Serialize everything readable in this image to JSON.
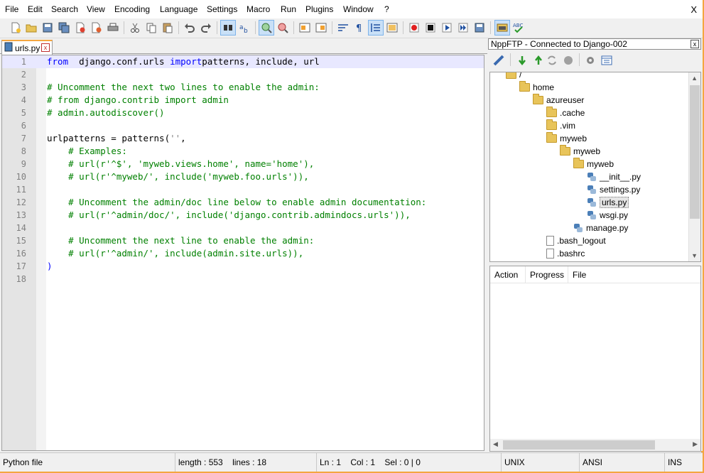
{
  "menu": {
    "items": [
      "File",
      "Edit",
      "Search",
      "View",
      "Encoding",
      "Language",
      "Settings",
      "Macro",
      "Run",
      "Plugins",
      "Window",
      "?"
    ],
    "close": "X"
  },
  "tab": {
    "label": "urls.py",
    "close": "x"
  },
  "editor": {
    "lines": [
      {
        "n": "1",
        "code": [
          [
            "kw",
            "from"
          ],
          [
            "",
            "  django.conf.urls "
          ],
          [
            "kw",
            "import"
          ],
          [
            "",
            "",
            " "
          ],
          [
            "",
            "patterns, include, url"
          ]
        ]
      },
      {
        "n": "2",
        "code": []
      },
      {
        "n": "3",
        "code": [
          [
            "cm",
            "# Uncomment the next two lines to enable the admin:"
          ]
        ]
      },
      {
        "n": "4",
        "code": [
          [
            "cm",
            "# from django.contrib import admin"
          ]
        ]
      },
      {
        "n": "5",
        "code": [
          [
            "cm",
            "# admin.autodiscover()"
          ]
        ]
      },
      {
        "n": "6",
        "code": []
      },
      {
        "n": "7",
        "code": [
          [
            "",
            "urlpatterns = patterns("
          ],
          [
            "st",
            "''"
          ],
          [
            "",
            ","
          ]
        ]
      },
      {
        "n": "8",
        "code": [
          [
            "",
            "    "
          ],
          [
            "cm",
            "# Examples:"
          ]
        ]
      },
      {
        "n": "9",
        "code": [
          [
            "",
            "    "
          ],
          [
            "cm",
            "# url(r'^$', 'myweb.views.home', name='home'),"
          ]
        ]
      },
      {
        "n": "10",
        "code": [
          [
            "",
            "    "
          ],
          [
            "cm",
            "# url(r'^myweb/', include('myweb.foo.urls')),"
          ]
        ]
      },
      {
        "n": "11",
        "code": []
      },
      {
        "n": "12",
        "code": [
          [
            "",
            "    "
          ],
          [
            "cm",
            "# Uncomment the admin/doc line below to enable admin documentation:"
          ]
        ]
      },
      {
        "n": "13",
        "code": [
          [
            "",
            "    "
          ],
          [
            "cm",
            "# url(r'^admin/doc/', include('django.contrib.admindocs.urls')),"
          ]
        ]
      },
      {
        "n": "14",
        "code": []
      },
      {
        "n": "15",
        "code": [
          [
            "",
            "    "
          ],
          [
            "cm",
            "# Uncomment the next line to enable the admin:"
          ]
        ]
      },
      {
        "n": "16",
        "code": [
          [
            "",
            "    "
          ],
          [
            "cm",
            "# url(r'^admin/', include(admin.site.urls)),"
          ]
        ]
      },
      {
        "n": "17",
        "code": [
          [
            "kw",
            ")"
          ]
        ]
      },
      {
        "n": "18",
        "code": []
      }
    ]
  },
  "ftp": {
    "title": "NppFTP - Connected to Django-002",
    "close": "x",
    "tree": [
      {
        "label": "/",
        "type": "folder",
        "depth": 0
      },
      {
        "label": "home",
        "type": "folder",
        "depth": 1
      },
      {
        "label": "azureuser",
        "type": "folder",
        "depth": 2
      },
      {
        "label": ".cache",
        "type": "folder",
        "depth": 3
      },
      {
        "label": ".vim",
        "type": "folder",
        "depth": 3
      },
      {
        "label": "myweb",
        "type": "folder",
        "depth": 3
      },
      {
        "label": "myweb",
        "type": "folder",
        "depth": 4
      },
      {
        "label": "myweb",
        "type": "folder",
        "depth": 5
      },
      {
        "label": "__init__.py",
        "type": "py",
        "depth": 6
      },
      {
        "label": "settings.py",
        "type": "py",
        "depth": 6
      },
      {
        "label": "urls.py",
        "type": "py",
        "depth": 6,
        "selected": true
      },
      {
        "label": "wsgi.py",
        "type": "py",
        "depth": 6
      },
      {
        "label": "manage.py",
        "type": "py",
        "depth": 5
      },
      {
        "label": ".bash_logout",
        "type": "doc",
        "depth": 3
      },
      {
        "label": ".bashrc",
        "type": "doc",
        "depth": 3
      }
    ],
    "queue_columns": [
      "Action",
      "Progress",
      "File"
    ]
  },
  "status": {
    "filetype": "Python file",
    "length": "length : 553",
    "lines": "lines : 18",
    "ln": "Ln : 1",
    "col": "Col : 1",
    "sel": "Sel : 0 | 0",
    "eol": "UNIX",
    "encoding": "ANSI",
    "mode": "INS"
  }
}
